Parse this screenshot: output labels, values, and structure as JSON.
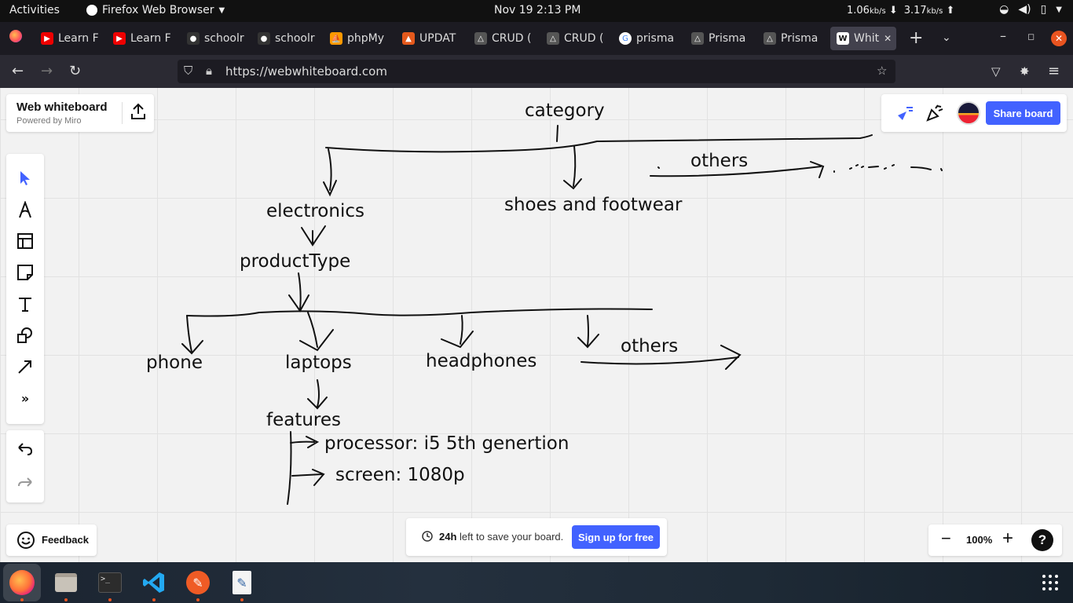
{
  "topbar": {
    "activities": "Activities",
    "app_name": "Firefox Web Browser",
    "clock": "Nov 19  2:13 PM",
    "down_rate": "1.06",
    "up_rate": "3.17",
    "rate_unit": "kb/s"
  },
  "tabs": [
    {
      "title": "Learn F",
      "icon": "youtube-icon",
      "color": "#e00"
    },
    {
      "title": "Learn F",
      "icon": "youtube-icon",
      "color": "#e00"
    },
    {
      "title": "schoolr",
      "icon": "github-icon",
      "color": "#333"
    },
    {
      "title": "schoolr",
      "icon": "github-icon",
      "color": "#333"
    },
    {
      "title": "phpMy",
      "icon": "phpmyadmin-icon",
      "color": "#f90"
    },
    {
      "title": "UPDAT",
      "icon": "codeigniter-icon",
      "color": "#e4591c"
    },
    {
      "title": "CRUD (",
      "icon": "prisma-icon",
      "color": "#555"
    },
    {
      "title": "CRUD (",
      "icon": "prisma-icon",
      "color": "#555"
    },
    {
      "title": "prisma",
      "icon": "google-icon",
      "color": "#fff"
    },
    {
      "title": "Prisma",
      "icon": "prisma-icon",
      "color": "#555"
    },
    {
      "title": "Prisma",
      "icon": "prisma-icon",
      "color": "#555"
    },
    {
      "title": "Whit",
      "icon": "whiteboard-icon",
      "color": "#fff"
    }
  ],
  "navbar": {
    "url": "https://webwhiteboard.com"
  },
  "brand": {
    "title": "Web whiteboard",
    "subtitle": "Powered by Miro"
  },
  "share_label": "Share board",
  "feedback_label": "Feedback",
  "save": {
    "bold": "24h",
    "rest": " left to save your board.",
    "signup": "Sign up for free"
  },
  "zoom": {
    "level": "100%",
    "help": "?"
  },
  "board": {
    "category": "category",
    "others_top": "others",
    "electronics": "electronics",
    "shoes": "shoes and footwear",
    "product_type": "productType",
    "phone": "phone",
    "laptops": "laptops",
    "headphones": "headphones",
    "others_mid": "others",
    "features": "features",
    "processor": "processor: i5 5th genertion",
    "screen": "screen: 1080p"
  },
  "colors": {
    "accent": "#4262ff",
    "board_bg": "#f2f2f2",
    "ubuntu_orange": "#e95420"
  }
}
